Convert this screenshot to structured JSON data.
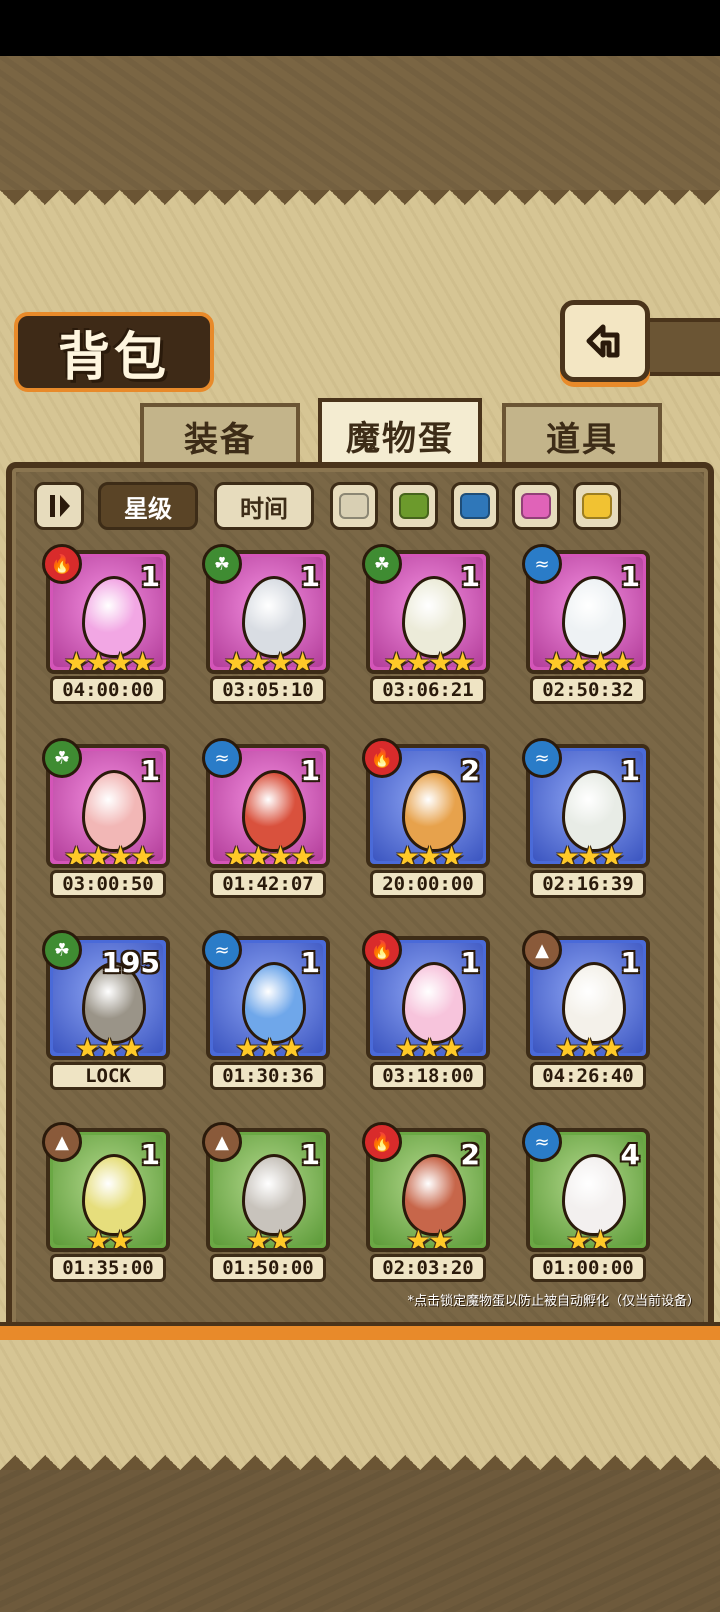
{
  "screen": {
    "title": "背包",
    "tabs": [
      {
        "label": "装备",
        "active": false
      },
      {
        "label": "魔物蛋",
        "active": true
      },
      {
        "label": "道具",
        "active": false
      }
    ],
    "sort_buttons": {
      "star_label": "星级",
      "time_label": "时间",
      "star_selected": true
    },
    "color_filters": [
      "#d8cfb3",
      "#6c9a2c",
      "#2f77b9",
      "#e063b8",
      "#f1c232"
    ],
    "footnote": "*点击锁定魔物蛋以防止被自动孵化（仅当前设备）"
  },
  "eggs": [
    {
      "element": "fire",
      "rarity": "purple",
      "stars": "★★★★",
      "count": "1",
      "timer": "04:00:00",
      "color": "#f2a7e4"
    },
    {
      "element": "leaf",
      "rarity": "purple",
      "stars": "★★★★",
      "count": "1",
      "timer": "03:05:10",
      "color": "#d9dde3"
    },
    {
      "element": "leaf",
      "rarity": "purple",
      "stars": "★★★★",
      "count": "1",
      "timer": "03:06:21",
      "color": "#ecebd9"
    },
    {
      "element": "water",
      "rarity": "purple",
      "stars": "★★★★",
      "count": "1",
      "timer": "02:50:32",
      "color": "#eef2f4"
    },
    {
      "element": "leaf",
      "rarity": "purple",
      "stars": "★★★★",
      "count": "1",
      "timer": "03:00:50",
      "color": "#f2b7b6"
    },
    {
      "element": "water",
      "rarity": "purple",
      "stars": "★★★★",
      "count": "1",
      "timer": "01:42:07",
      "color": "#d9513d"
    },
    {
      "element": "fire",
      "rarity": "blue",
      "stars": "★★★",
      "count": "2",
      "timer": "20:00:00",
      "color": "#e7a24c"
    },
    {
      "element": "water",
      "rarity": "blue",
      "stars": "★★★",
      "count": "1",
      "timer": "02:16:39",
      "color": "#e8ece6"
    },
    {
      "element": "leaf",
      "rarity": "blue",
      "stars": "★★★",
      "count": "195",
      "timer": "LOCK",
      "color": "#9a9488"
    },
    {
      "element": "water",
      "rarity": "blue",
      "stars": "★★★",
      "count": "1",
      "timer": "01:30:36",
      "color": "#6fa7ea"
    },
    {
      "element": "fire",
      "rarity": "blue",
      "stars": "★★★",
      "count": "1",
      "timer": "03:18:00",
      "color": "#f7c4dc"
    },
    {
      "element": "earth",
      "rarity": "blue",
      "stars": "★★★",
      "count": "1",
      "timer": "04:26:40",
      "color": "#f4f1ea"
    },
    {
      "element": "earth",
      "rarity": "green",
      "stars": "★★",
      "count": "1",
      "timer": "01:35:00",
      "color": "#e6de7c"
    },
    {
      "element": "earth",
      "rarity": "green",
      "stars": "★★",
      "count": "1",
      "timer": "01:50:00",
      "color": "#c8c3bc"
    },
    {
      "element": "fire",
      "rarity": "green",
      "stars": "★★",
      "count": "2",
      "timer": "02:03:20",
      "color": "#c7664a"
    },
    {
      "element": "water",
      "rarity": "green",
      "stars": "★★",
      "count": "4",
      "timer": "01:00:00",
      "color": "#f3f0ef"
    }
  ]
}
